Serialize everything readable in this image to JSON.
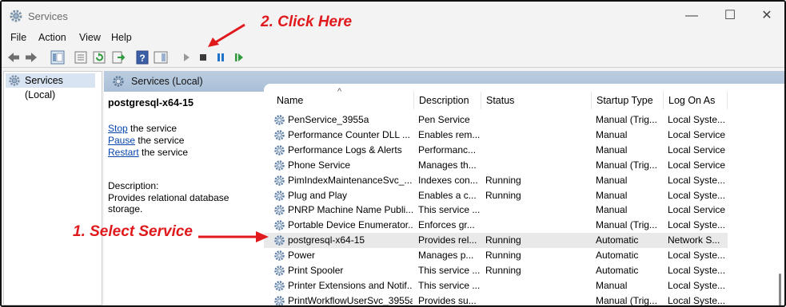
{
  "window": {
    "title": "Services",
    "minimize": "—",
    "maximize": "☐",
    "close": "✕"
  },
  "menu": [
    "File",
    "Action",
    "View",
    "Help"
  ],
  "tree": {
    "item": "Services (Local)"
  },
  "pane_header": "Services (Local)",
  "details": {
    "service_name": "postgresql-x64-15",
    "actions": [
      {
        "link": "Stop",
        "rest": " the service"
      },
      {
        "link": "Pause",
        "rest": " the service"
      },
      {
        "link": "Restart",
        "rest": " the service"
      }
    ],
    "description_label": "Description:",
    "description": "Provides relational database storage."
  },
  "columns": [
    "Name",
    "Description",
    "Status",
    "Startup Type",
    "Log On As"
  ],
  "sort_indicator": "^",
  "rows": [
    {
      "name": "PenService_3955a",
      "description": "Pen Service",
      "status": "",
      "startup": "Manual (Trig...",
      "logon": "Local Syste..."
    },
    {
      "name": "Performance Counter DLL ...",
      "description": "Enables rem...",
      "status": "",
      "startup": "Manual",
      "logon": "Local Service"
    },
    {
      "name": "Performance Logs & Alerts",
      "description": "Performanc...",
      "status": "",
      "startup": "Manual",
      "logon": "Local Service"
    },
    {
      "name": "Phone Service",
      "description": "Manages th...",
      "status": "",
      "startup": "Manual (Trig...",
      "logon": "Local Service"
    },
    {
      "name": "PimIndexMaintenanceSvc_...",
      "description": "Indexes con...",
      "status": "Running",
      "startup": "Manual",
      "logon": "Local Syste..."
    },
    {
      "name": "Plug and Play",
      "description": "Enables a c...",
      "status": "Running",
      "startup": "Manual",
      "logon": "Local Syste..."
    },
    {
      "name": "PNRP Machine Name Publi...",
      "description": "This service ...",
      "status": "",
      "startup": "Manual",
      "logon": "Local Service"
    },
    {
      "name": "Portable Device Enumerator...",
      "description": "Enforces gr...",
      "status": "",
      "startup": "Manual (Trig...",
      "logon": "Local Syste..."
    },
    {
      "name": "postgresql-x64-15",
      "description": "Provides rel...",
      "status": "Running",
      "startup": "Automatic",
      "logon": "Network S..."
    },
    {
      "name": "Power",
      "description": "Manages p...",
      "status": "Running",
      "startup": "Automatic",
      "logon": "Local Syste..."
    },
    {
      "name": "Print Spooler",
      "description": "This service ...",
      "status": "Running",
      "startup": "Automatic",
      "logon": "Local Syste..."
    },
    {
      "name": "Printer Extensions and Notif...",
      "description": "This service ...",
      "status": "",
      "startup": "Manual",
      "logon": "Local Syste..."
    },
    {
      "name": "PrintWorkflowUserSvc_3955a",
      "description": "Provides su...",
      "status": "",
      "startup": "Manual (Trig...",
      "logon": "Local Syste..."
    }
  ],
  "selected_row": 8,
  "annotations": {
    "select": "1. Select Service",
    "click": "2. Click Here"
  },
  "colors": {
    "annotation": "#e0191c",
    "header_bar": "#b3c6dc",
    "link": "#0645ad"
  }
}
